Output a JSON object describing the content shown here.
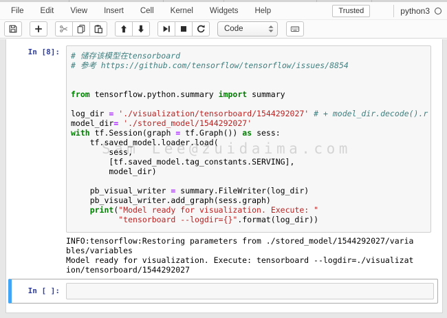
{
  "menubar": {
    "items": [
      "File",
      "Edit",
      "View",
      "Insert",
      "Cell",
      "Kernel",
      "Widgets",
      "Help"
    ],
    "trusted_label": "Trusted",
    "kernel_name": "python3"
  },
  "toolbar": {
    "groups": [
      {
        "buttons": [
          {
            "name": "save-notebook",
            "icon": "save-icon"
          }
        ]
      },
      {
        "buttons": [
          {
            "name": "add-cell",
            "icon": "plus-icon"
          }
        ]
      },
      {
        "buttons": [
          {
            "name": "cut-cell",
            "icon": "scissors-icon"
          },
          {
            "name": "copy-cell",
            "icon": "copy-icon"
          },
          {
            "name": "paste-cell",
            "icon": "paste-icon"
          }
        ]
      },
      {
        "buttons": [
          {
            "name": "move-cell-up",
            "icon": "arrow-up-icon"
          },
          {
            "name": "move-cell-down",
            "icon": "arrow-down-icon"
          }
        ]
      },
      {
        "buttons": [
          {
            "name": "run-cell",
            "icon": "step-forward-icon"
          },
          {
            "name": "interrupt-kernel",
            "icon": "stop-icon"
          },
          {
            "name": "restart-kernel",
            "icon": "restart-icon"
          }
        ]
      }
    ],
    "cell_type_value": "Code",
    "command_palette_icon": "keyboard-icon"
  },
  "notebook": {
    "cell1": {
      "prompt": "In [8]:",
      "code_lines": [
        [
          [
            "c",
            "# 储存该模型在tensorboard"
          ]
        ],
        [
          [
            "c",
            "# 参考 https://github.com/tensorflow/tensorflow/issues/8854"
          ]
        ],
        [],
        [],
        [
          [
            "k",
            "from"
          ],
          [
            "p",
            " tensorflow.python.summary "
          ],
          [
            "k",
            "import"
          ],
          [
            "p",
            " summary"
          ]
        ],
        [],
        [
          [
            "p",
            "log_dir "
          ],
          [
            "o",
            "="
          ],
          [
            "p",
            " "
          ],
          [
            "s",
            "'./visualization/tensorboard/1544292027'"
          ],
          [
            "p",
            " "
          ],
          [
            "c",
            "# + model_dir.decode().r"
          ]
        ],
        [
          [
            "p",
            "model_dir"
          ],
          [
            "o",
            "="
          ],
          [
            "p",
            " "
          ],
          [
            "s",
            "'./stored_model/1544292027'"
          ]
        ],
        [
          [
            "k",
            "with"
          ],
          [
            "p",
            " tf.Session(graph "
          ],
          [
            "o",
            "="
          ],
          [
            "p",
            " tf.Graph()) "
          ],
          [
            "k",
            "as"
          ],
          [
            "p",
            " sess:"
          ]
        ],
        [
          [
            "p",
            "    tf.saved_model.loader.load("
          ]
        ],
        [
          [
            "p",
            "        sess,"
          ]
        ],
        [
          [
            "p",
            "        [tf.saved_model.tag_constants.SERVING],"
          ]
        ],
        [
          [
            "p",
            "        model_dir)"
          ]
        ],
        [],
        [
          [
            "p",
            "    pb_visual_writer "
          ],
          [
            "o",
            "="
          ],
          [
            "p",
            " summary.FileWriter(log_dir)"
          ]
        ],
        [
          [
            "p",
            "    pb_visual_writer.add_graph(sess.graph)"
          ]
        ],
        [
          [
            "p",
            "    "
          ],
          [
            "b",
            "print"
          ],
          [
            "p",
            "("
          ],
          [
            "s",
            "\"Model ready for visualization. Execute: \""
          ]
        ],
        [
          [
            "p",
            "          "
          ],
          [
            "s",
            "\"tensorboard --logdir={}\""
          ],
          [
            "p",
            ".format(log_dir))"
          ]
        ]
      ],
      "output_lines": [
        "INFO:tensorflow:Restoring parameters from ./stored_model/1544292027/varia",
        "bles/variables",
        "Model ready for visualization. Execute: tensorboard --logdir=./visualizat",
        "ion/tensorboard/1544292027"
      ]
    },
    "cell2": {
      "prompt": "In [ ]:"
    }
  },
  "watermark_text": "Sam Lee@zuidaima.com",
  "colors": {
    "selection_accent": "#42A5F5",
    "prompt_blue": "#303F9F",
    "comment_teal": "#408080",
    "keyword_green": "#008000",
    "string_red": "#BA2121",
    "operator_purple": "#AA22FF"
  }
}
